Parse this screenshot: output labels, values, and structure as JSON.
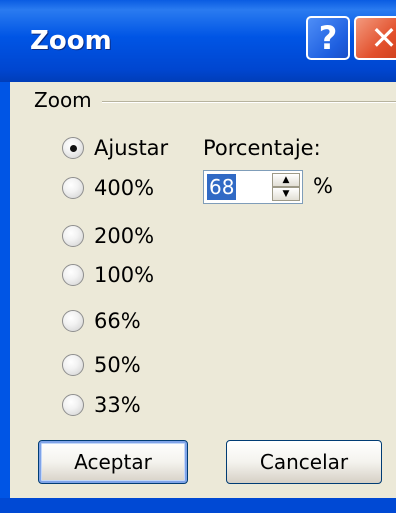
{
  "window": {
    "title": "Zoom",
    "help_glyph": "?",
    "close_glyph": "✕"
  },
  "group": {
    "label": "Zoom"
  },
  "radio_options": [
    {
      "label": "Ajustar",
      "checked": true
    },
    {
      "label": "400%",
      "checked": false
    },
    {
      "label": "200%",
      "checked": false
    },
    {
      "label": "100%",
      "checked": false
    },
    {
      "label": "66%",
      "checked": false
    },
    {
      "label": "50%",
      "checked": false
    },
    {
      "label": "33%",
      "checked": false
    }
  ],
  "percentage": {
    "label": "Porcentaje:",
    "value": "68",
    "unit": "%"
  },
  "buttons": {
    "ok_label": "Aceptar",
    "cancel_label": "Cancelar"
  },
  "icons": {
    "help": "help-icon",
    "close": "close-icon",
    "spin_up": "arrow-up-icon",
    "spin_down": "arrow-down-icon"
  },
  "colors": {
    "titlebar": "#0055E5",
    "dialog_face": "#ECE9D8",
    "close_button": "#E2502C",
    "selection": "#316AC5"
  }
}
